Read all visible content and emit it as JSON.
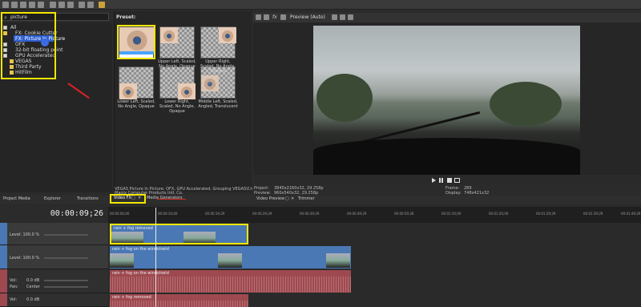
{
  "colors": {
    "highlight": "#f2e600",
    "video_track": "#4a78b5",
    "audio_track": "#9e4950",
    "selection": "#2f5fd0"
  },
  "explorer": {
    "search_value": "picture",
    "items": [
      {
        "label": "All",
        "icon": "folder-icon"
      },
      {
        "label": "FX: Cookie Cutter",
        "icon": "fx-icon"
      },
      {
        "label": "FX: Picture In Picture",
        "icon": "fx-icon"
      },
      {
        "label": "OFX",
        "icon": "folder-icon"
      },
      {
        "label": "32-bit floating point",
        "icon": "folder-icon"
      },
      {
        "label": "GPU Accelerated",
        "icon": "folder-icon"
      },
      {
        "label": "VEGAS",
        "icon": "folder-icon"
      },
      {
        "label": "Third Party",
        "icon": "folder-icon"
      },
      {
        "label": "HitFilm",
        "icon": "folder-icon"
      }
    ]
  },
  "presets": {
    "title": "Preset:",
    "items": [
      {
        "label": ""
      },
      {
        "label": "Upper Left, Scaled, No Angle, Opaque"
      },
      {
        "label": "Upper Right, Scaled, No Angle, Opaque"
      },
      {
        "label": "Lower Left, Scaled, No Angle, Opaque"
      },
      {
        "label": "Lower Right, Scaled, No Angle, Opaque"
      },
      {
        "label": "Middle Left, Scaled, Angled, Translucent"
      }
    ],
    "description_line1": "VEGAS Picture In Picture: OFX, GPU Accelerated, Grouping VEGAS\\Creative, Ve",
    "description_line2": "Magix Computer Products Intl. Co."
  },
  "preview": {
    "mode": "Preview (Auto)",
    "project_label": "Project:",
    "project_value": "3840x2160x32, 29.258p",
    "preview_label": "Preview:",
    "preview_value": "960x540x32, 29.258p",
    "frame_label": "Frame:",
    "frame_value": "289",
    "display_label": "Display:",
    "display_value": "748x421x32"
  },
  "tabs": {
    "left": [
      "Project Media",
      "Explorer",
      "Transitions"
    ],
    "video_fx": "Video FX",
    "media_generators": "Media Generators",
    "right": [
      "Video Preview",
      "Trimmer"
    ]
  },
  "timeline": {
    "timecode": "00:00:09;26",
    "ruler": [
      "00:00:00;00",
      "00:00:10;00",
      "00:00:19;29",
      "00:00:29;29",
      "00:00:39;29",
      "00:00:49;29",
      "00:00:59;28",
      "00:01:10;00",
      "00:01:20;00",
      "00:01:29;29",
      "00:01:39;29",
      "00:01:49;29"
    ],
    "tracks": [
      {
        "type": "video",
        "level": "Level: 100.0 %",
        "clip": "rain + fog removed"
      },
      {
        "type": "video",
        "level": "Level: 100.0 %",
        "clip": "rain + fog on the windshield"
      },
      {
        "type": "audio",
        "vol": "Vol:",
        "vol_value": "0.0 dB",
        "pan": "Pan:",
        "pan_value": "Center",
        "clip": "rain + fog on the windshield"
      },
      {
        "type": "audio",
        "vol": "Vol:",
        "vol_value": "0.0 dB",
        "clip": "rain + fog removed"
      }
    ]
  }
}
